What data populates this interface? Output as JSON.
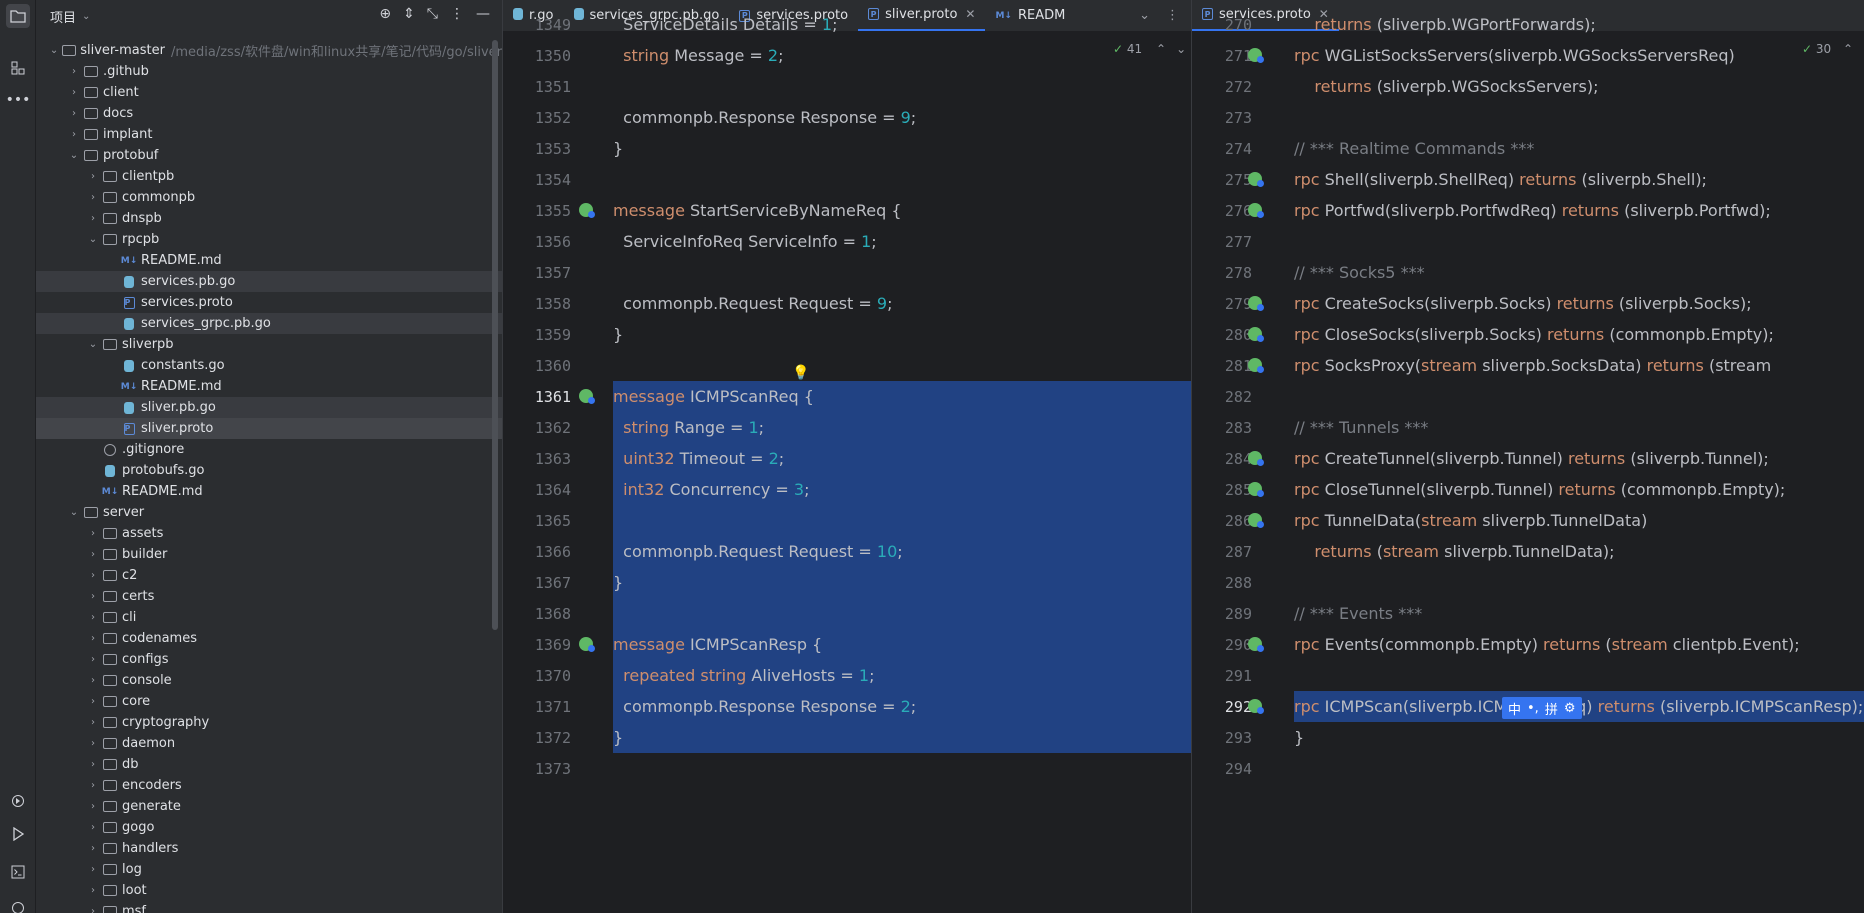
{
  "project": {
    "title": "项目",
    "root_name": "sliver-master",
    "root_path": "/media/zss/软件盘/win和linux共享/笔记/代码/go/sliver"
  },
  "tree": [
    {
      "label": ".github",
      "type": "folder",
      "depth": 1,
      "expanded": false
    },
    {
      "label": "client",
      "type": "folder",
      "depth": 1,
      "expanded": false
    },
    {
      "label": "docs",
      "type": "folder",
      "depth": 1,
      "expanded": false
    },
    {
      "label": "implant",
      "type": "folder",
      "depth": 1,
      "expanded": false
    },
    {
      "label": "protobuf",
      "type": "folder",
      "depth": 1,
      "expanded": true
    },
    {
      "label": "clientpb",
      "type": "folder",
      "depth": 2,
      "expanded": false
    },
    {
      "label": "commonpb",
      "type": "folder",
      "depth": 2,
      "expanded": false
    },
    {
      "label": "dnspb",
      "type": "folder",
      "depth": 2,
      "expanded": false
    },
    {
      "label": "rpcpb",
      "type": "folder",
      "depth": 2,
      "expanded": true
    },
    {
      "label": "README.md",
      "type": "md",
      "depth": 3
    },
    {
      "label": "services.pb.go",
      "type": "go",
      "depth": 3,
      "state": "sel2"
    },
    {
      "label": "services.proto",
      "type": "proto",
      "depth": 3
    },
    {
      "label": "services_grpc.pb.go",
      "type": "go",
      "depth": 3,
      "state": "sel2"
    },
    {
      "label": "sliverpb",
      "type": "folder",
      "depth": 2,
      "expanded": true
    },
    {
      "label": "constants.go",
      "type": "go",
      "depth": 3
    },
    {
      "label": "README.md",
      "type": "md",
      "depth": 3
    },
    {
      "label": "sliver.pb.go",
      "type": "go",
      "depth": 3,
      "state": "sel2"
    },
    {
      "label": "sliver.proto",
      "type": "proto",
      "depth": 3,
      "state": "sel"
    },
    {
      "label": ".gitignore",
      "type": "ignore",
      "depth": 2
    },
    {
      "label": "protobufs.go",
      "type": "go",
      "depth": 2
    },
    {
      "label": "README.md",
      "type": "md",
      "depth": 2
    },
    {
      "label": "server",
      "type": "folder",
      "depth": 1,
      "expanded": true
    },
    {
      "label": "assets",
      "type": "folder",
      "depth": 2,
      "expanded": false
    },
    {
      "label": "builder",
      "type": "folder",
      "depth": 2,
      "expanded": false
    },
    {
      "label": "c2",
      "type": "folder",
      "depth": 2,
      "expanded": false
    },
    {
      "label": "certs",
      "type": "folder",
      "depth": 2,
      "expanded": false
    },
    {
      "label": "cli",
      "type": "folder",
      "depth": 2,
      "expanded": false
    },
    {
      "label": "codenames",
      "type": "folder",
      "depth": 2,
      "expanded": false
    },
    {
      "label": "configs",
      "type": "folder",
      "depth": 2,
      "expanded": false
    },
    {
      "label": "console",
      "type": "folder",
      "depth": 2,
      "expanded": false
    },
    {
      "label": "core",
      "type": "folder",
      "depth": 2,
      "expanded": false
    },
    {
      "label": "cryptography",
      "type": "folder",
      "depth": 2,
      "expanded": false
    },
    {
      "label": "daemon",
      "type": "folder",
      "depth": 2,
      "expanded": false
    },
    {
      "label": "db",
      "type": "folder",
      "depth": 2,
      "expanded": false
    },
    {
      "label": "encoders",
      "type": "folder",
      "depth": 2,
      "expanded": false
    },
    {
      "label": "generate",
      "type": "folder",
      "depth": 2,
      "expanded": false
    },
    {
      "label": "gogo",
      "type": "folder",
      "depth": 2,
      "expanded": false
    },
    {
      "label": "handlers",
      "type": "folder",
      "depth": 2,
      "expanded": false
    },
    {
      "label": "log",
      "type": "folder",
      "depth": 2,
      "expanded": false
    },
    {
      "label": "loot",
      "type": "folder",
      "depth": 2,
      "expanded": false
    },
    {
      "label": "msf",
      "type": "folder",
      "depth": 2,
      "expanded": false
    }
  ],
  "left_editor": {
    "tabs": [
      {
        "label": "r.go",
        "icon": "go"
      },
      {
        "label": "services_grpc.pb.go",
        "icon": "go"
      },
      {
        "label": "services.proto",
        "icon": "proto"
      },
      {
        "label": "sliver.proto",
        "icon": "proto",
        "active": true,
        "closable": true
      },
      {
        "label": "READM",
        "icon": "md"
      }
    ],
    "inspection_count": "41",
    "current_line": "1361",
    "lines": [
      {
        "n": "1349",
        "text": "  ServiceDetails Details = 1;",
        "tokens": [
          [
            "tx",
            "  ServiceDetails Details = "
          ],
          [
            "nm",
            "1"
          ],
          [
            "tx",
            ";"
          ]
        ]
      },
      {
        "n": "1350",
        "tokens": [
          [
            "tx",
            "  "
          ],
          [
            "kw",
            "string"
          ],
          [
            "tx",
            " Message = "
          ],
          [
            "nm",
            "2"
          ],
          [
            "tx",
            ";"
          ]
        ]
      },
      {
        "n": "1351",
        "tokens": []
      },
      {
        "n": "1352",
        "tokens": [
          [
            "tx",
            "  commonpb.Response Response = "
          ],
          [
            "nm",
            "9"
          ],
          [
            "tx",
            ";"
          ]
        ]
      },
      {
        "n": "1353",
        "tokens": [
          [
            "tx",
            "}"
          ]
        ]
      },
      {
        "n": "1354",
        "tokens": []
      },
      {
        "n": "1355",
        "gicon": true,
        "tokens": [
          [
            "kw",
            "message"
          ],
          [
            "tx",
            " StartServiceByNameReq {"
          ]
        ]
      },
      {
        "n": "1356",
        "tokens": [
          [
            "tx",
            "  ServiceInfoReq ServiceInfo = "
          ],
          [
            "nm",
            "1"
          ],
          [
            "tx",
            ";"
          ]
        ]
      },
      {
        "n": "1357",
        "tokens": []
      },
      {
        "n": "1358",
        "tokens": [
          [
            "tx",
            "  commonpb.Request Request = "
          ],
          [
            "nm",
            "9"
          ],
          [
            "tx",
            ";"
          ]
        ]
      },
      {
        "n": "1359",
        "tokens": [
          [
            "tx",
            "}"
          ]
        ]
      },
      {
        "n": "1360",
        "tokens": []
      },
      {
        "n": "1361",
        "gicon": true,
        "hl": true,
        "tokens": [
          [
            "kw",
            "message"
          ],
          [
            "tx",
            " ICMPScanReq {"
          ]
        ]
      },
      {
        "n": "1362",
        "hl": true,
        "tokens": [
          [
            "tx",
            "  "
          ],
          [
            "kw",
            "string"
          ],
          [
            "tx",
            " Range = "
          ],
          [
            "nm",
            "1"
          ],
          [
            "tx",
            ";"
          ]
        ]
      },
      {
        "n": "1363",
        "hl": true,
        "tokens": [
          [
            "tx",
            "  "
          ],
          [
            "kw",
            "uint32"
          ],
          [
            "tx",
            " Timeout = "
          ],
          [
            "nm",
            "2"
          ],
          [
            "tx",
            ";"
          ]
        ]
      },
      {
        "n": "1364",
        "hl": true,
        "tokens": [
          [
            "tx",
            "  "
          ],
          [
            "kw",
            "int32"
          ],
          [
            "tx",
            " Concurrency = "
          ],
          [
            "nm",
            "3"
          ],
          [
            "tx",
            ";"
          ]
        ]
      },
      {
        "n": "1365",
        "hl": true,
        "tokens": []
      },
      {
        "n": "1366",
        "hl": true,
        "tokens": [
          [
            "tx",
            "  commonpb.Request Request = "
          ],
          [
            "nm",
            "10"
          ],
          [
            "tx",
            ";"
          ]
        ]
      },
      {
        "n": "1367",
        "hl": true,
        "tokens": [
          [
            "tx",
            "}"
          ]
        ]
      },
      {
        "n": "1368",
        "hl": true,
        "tokens": []
      },
      {
        "n": "1369",
        "gicon": true,
        "hl": true,
        "tokens": [
          [
            "kw",
            "message"
          ],
          [
            "tx",
            " ICMPScanResp {"
          ]
        ]
      },
      {
        "n": "1370",
        "hl": true,
        "tokens": [
          [
            "tx",
            "  "
          ],
          [
            "kw",
            "repeated string"
          ],
          [
            "tx",
            " AliveHosts = "
          ],
          [
            "nm",
            "1"
          ],
          [
            "tx",
            ";"
          ]
        ]
      },
      {
        "n": "1371",
        "hl": true,
        "tokens": [
          [
            "tx",
            "  commonpb.Response Response = "
          ],
          [
            "nm",
            "2"
          ],
          [
            "tx",
            ";"
          ]
        ]
      },
      {
        "n": "1372",
        "hl": true,
        "tokens": [
          [
            "tx",
            "}"
          ]
        ]
      },
      {
        "n": "1373",
        "tokens": []
      }
    ]
  },
  "right_editor": {
    "tabs": [
      {
        "label": "services.proto",
        "icon": "proto",
        "active": true,
        "closable": true
      }
    ],
    "inspection_count": "30",
    "current_line": "292",
    "lines": [
      {
        "n": "270",
        "tokens": [
          [
            "tx",
            "    "
          ],
          [
            "kw",
            "returns"
          ],
          [
            "tx",
            " (sliverpb.WGPortForwards);"
          ]
        ]
      },
      {
        "n": "271",
        "gicon": true,
        "tokens": [
          [
            "kw",
            "rpc"
          ],
          [
            "tx",
            " WGListSocksServers(sliverpb.WGSocksServersReq)"
          ]
        ]
      },
      {
        "n": "272",
        "tokens": [
          [
            "tx",
            "    "
          ],
          [
            "kw",
            "returns"
          ],
          [
            "tx",
            " (sliverpb.WGSocksServers);"
          ]
        ]
      },
      {
        "n": "273",
        "tokens": []
      },
      {
        "n": "274",
        "tokens": [
          [
            "cm",
            "// *** Realtime Commands ***"
          ]
        ]
      },
      {
        "n": "275",
        "gicon": true,
        "tokens": [
          [
            "kw",
            "rpc"
          ],
          [
            "tx",
            " Shell(sliverpb.ShellReq) "
          ],
          [
            "kw",
            "returns"
          ],
          [
            "tx",
            " (sliverpb.Shell);"
          ]
        ]
      },
      {
        "n": "276",
        "gicon": true,
        "tokens": [
          [
            "kw",
            "rpc"
          ],
          [
            "tx",
            " Portfwd(sliverpb.PortfwdReq) "
          ],
          [
            "kw",
            "returns"
          ],
          [
            "tx",
            " (sliverpb.Portfwd);"
          ]
        ]
      },
      {
        "n": "277",
        "tokens": []
      },
      {
        "n": "278",
        "tokens": [
          [
            "cm",
            "// *** Socks5 ***"
          ]
        ]
      },
      {
        "n": "279",
        "gicon": true,
        "tokens": [
          [
            "kw",
            "rpc"
          ],
          [
            "tx",
            " CreateSocks(sliverpb.Socks) "
          ],
          [
            "kw",
            "returns"
          ],
          [
            "tx",
            " (sliverpb.Socks);"
          ]
        ]
      },
      {
        "n": "280",
        "gicon": true,
        "tokens": [
          [
            "kw",
            "rpc"
          ],
          [
            "tx",
            " CloseSocks(sliverpb.Socks) "
          ],
          [
            "kw",
            "returns"
          ],
          [
            "tx",
            " (commonpb.Empty);"
          ]
        ]
      },
      {
        "n": "281",
        "gicon": true,
        "tokens": [
          [
            "kw",
            "rpc"
          ],
          [
            "tx",
            " SocksProxy("
          ],
          [
            "kw",
            "stream"
          ],
          [
            "tx",
            " sliverpb.SocksData) "
          ],
          [
            "kw",
            "returns"
          ],
          [
            "tx",
            " (stream"
          ]
        ]
      },
      {
        "n": "282",
        "tokens": []
      },
      {
        "n": "283",
        "tokens": [
          [
            "cm",
            "// *** Tunnels ***"
          ]
        ]
      },
      {
        "n": "284",
        "gicon": true,
        "tokens": [
          [
            "kw",
            "rpc"
          ],
          [
            "tx",
            " CreateTunnel(sliverpb.Tunnel) "
          ],
          [
            "kw",
            "returns"
          ],
          [
            "tx",
            " (sliverpb.Tunnel);"
          ]
        ]
      },
      {
        "n": "285",
        "gicon": true,
        "tokens": [
          [
            "kw",
            "rpc"
          ],
          [
            "tx",
            " CloseTunnel(sliverpb.Tunnel) "
          ],
          [
            "kw",
            "returns"
          ],
          [
            "tx",
            " (commonpb.Empty);"
          ]
        ]
      },
      {
        "n": "286",
        "gicon": true,
        "tokens": [
          [
            "kw",
            "rpc"
          ],
          [
            "tx",
            " TunnelData("
          ],
          [
            "kw",
            "stream"
          ],
          [
            "tx",
            " sliverpb.TunnelData)"
          ]
        ]
      },
      {
        "n": "287",
        "tokens": [
          [
            "tx",
            "    "
          ],
          [
            "kw",
            "returns"
          ],
          [
            "tx",
            " ("
          ],
          [
            "kw",
            "stream"
          ],
          [
            "tx",
            " sliverpb.TunnelData);"
          ]
        ]
      },
      {
        "n": "288",
        "tokens": []
      },
      {
        "n": "289",
        "tokens": [
          [
            "cm",
            "// *** Events ***"
          ]
        ]
      },
      {
        "n": "290",
        "gicon": true,
        "tokens": [
          [
            "kw",
            "rpc"
          ],
          [
            "tx",
            " Events(commonpb.Empty) "
          ],
          [
            "kw",
            "returns"
          ],
          [
            "tx",
            " ("
          ],
          [
            "kw",
            "stream"
          ],
          [
            "tx",
            " clientpb.Event);"
          ]
        ]
      },
      {
        "n": "291",
        "tokens": []
      },
      {
        "n": "292",
        "gicon": true,
        "hl": true,
        "tokens": [
          [
            "kw",
            "rpc"
          ],
          [
            "tx",
            " ICMPScan(sliverpb.ICMPScanReq) "
          ],
          [
            "kw",
            "returns"
          ],
          [
            "tx",
            " (sliverpb.ICMPScanResp);"
          ]
        ]
      },
      {
        "n": "293",
        "tokens": [
          [
            "tx",
            "}"
          ]
        ]
      },
      {
        "n": "294",
        "tokens": []
      }
    ]
  },
  "ime": {
    "label_zh": "中",
    "label_punct": "•,",
    "label_pin": "拼",
    "settings": "⚙"
  },
  "colors": {
    "selection": "#214283",
    "accent": "#3574f0",
    "keyword": "#cf8e6d",
    "number": "#2aacb8",
    "comment": "#7a7e85"
  }
}
